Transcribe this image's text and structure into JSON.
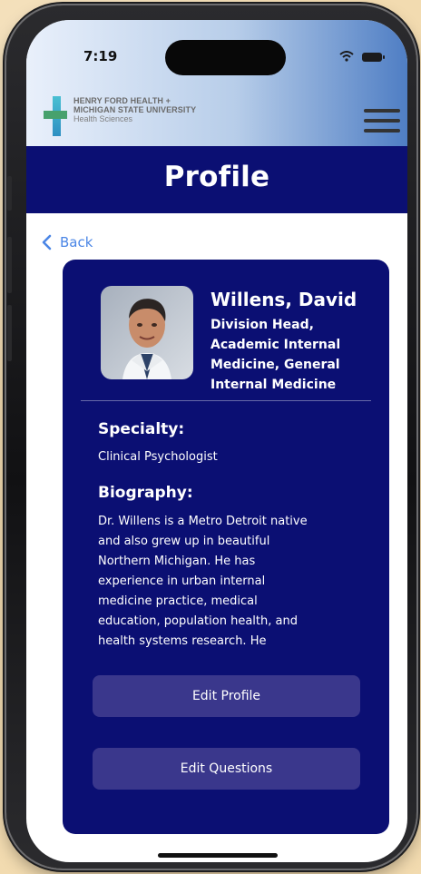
{
  "status_bar": {
    "time": "7:19",
    "icons": [
      "wifi-icon",
      "battery-icon"
    ]
  },
  "header": {
    "logo": {
      "line1": "HENRY FORD HEALTH +",
      "line2": "MICHIGAN STATE UNIVERSITY",
      "line3": "Health Sciences"
    },
    "menu_icon": "hamburger-menu-icon",
    "title": "Profile"
  },
  "navigation": {
    "back_label": "Back"
  },
  "profile": {
    "name": "Willens, David",
    "title_lines": [
      "Division Head,",
      "Academic Internal",
      "Medicine, General",
      "Internal Medicine"
    ],
    "specialty_heading": "Specialty:",
    "specialty": "Clinical Psychologist",
    "biography_heading": "Biography:",
    "biography_lines": [
      "Dr. Willens is a Metro Detroit native",
      "and also grew up in beautiful",
      "Northern Michigan. He has",
      "experience in urban internal",
      "medicine practice, medical",
      "education, population health, and",
      "health systems research. He"
    ]
  },
  "actions": {
    "edit_profile": "Edit Profile",
    "edit_questions": "Edit Questions"
  },
  "colors": {
    "brand_navy": "#0b0f73",
    "button_purple": "#3a378c",
    "link_blue": "#4b86e6",
    "background": "#f2dbb0"
  }
}
